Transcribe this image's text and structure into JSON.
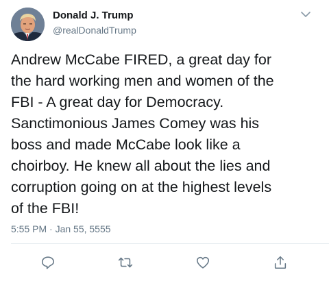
{
  "tweet": {
    "display_name": "Donald J. Trump",
    "handle": "@realDonaldTrump",
    "text": "Andrew McCabe FIRED, a great day for\nthe hard working men and women of the\nFBI - A great day for Democracy.\nSanctimonious James Comey was his\nboss and made McCabe look like a\nchoirboy. He knew all about the lies and\ncorruption going on at the highest levels\nof the FBI!",
    "timestamp": "5:55 PM · Jan 55, 5555"
  },
  "icons": {
    "avatar": "profile-photo",
    "caret": "chevron-down-icon",
    "reply": "reply-icon",
    "retweet": "retweet-icon",
    "like": "heart-icon",
    "share": "share-icon"
  },
  "colors": {
    "text": "#14171a",
    "secondary": "#657786",
    "icon": "#657786",
    "divider": "#e6ecf0"
  }
}
